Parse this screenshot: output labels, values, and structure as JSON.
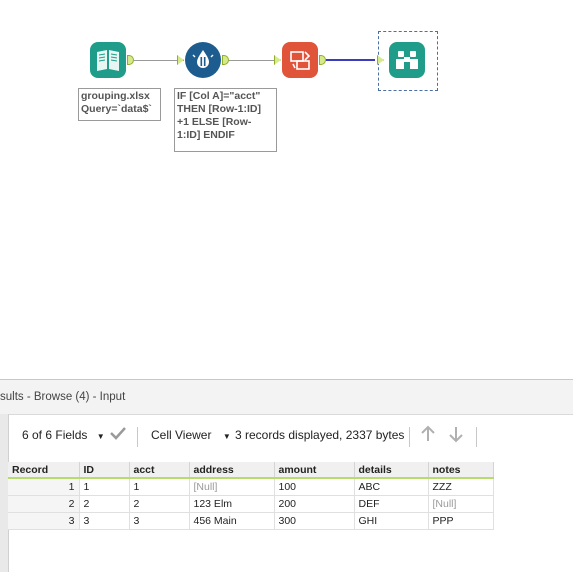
{
  "workflow": {
    "input_tool": {
      "icon": "book-icon",
      "annotation": [
        "grouping.xlsx",
        "Query=`data$`"
      ]
    },
    "formula_tool": {
      "icon": "multi-row-formula-icon",
      "annotation": [
        "IF [Col A]=\"acct\"",
        "THEN [Row-1:ID]",
        "+1 ELSE [Row-",
        "1:ID] ENDIF"
      ]
    },
    "crosstab_tool": {
      "icon": "crosstab-icon"
    },
    "browse_tool": {
      "icon": "binoculars-icon"
    },
    "colors": {
      "input": "#1f9d8a",
      "formula": "#1d5c8f",
      "crosstab": "#e0543a",
      "browse": "#1f9d8a",
      "selected_connection": "#3b3bbd"
    }
  },
  "results": {
    "title": "sults - Browse (4) - Input",
    "fields_label": "6 of 6 Fields",
    "viewer_label": "Cell Viewer",
    "records_info": "3 records displayed, 2337 bytes",
    "columns": [
      "Record",
      "ID",
      "acct",
      "address",
      "amount",
      "details",
      "notes"
    ],
    "rows": [
      [
        "1",
        "1",
        "1",
        "[Null]",
        "100",
        "ABC",
        "ZZZ"
      ],
      [
        "2",
        "2",
        "2",
        "123 Elm",
        "200",
        "DEF",
        "[Null]"
      ],
      [
        "3",
        "3",
        "3",
        "456 Main",
        "300",
        "GHI",
        "PPP"
      ]
    ]
  }
}
